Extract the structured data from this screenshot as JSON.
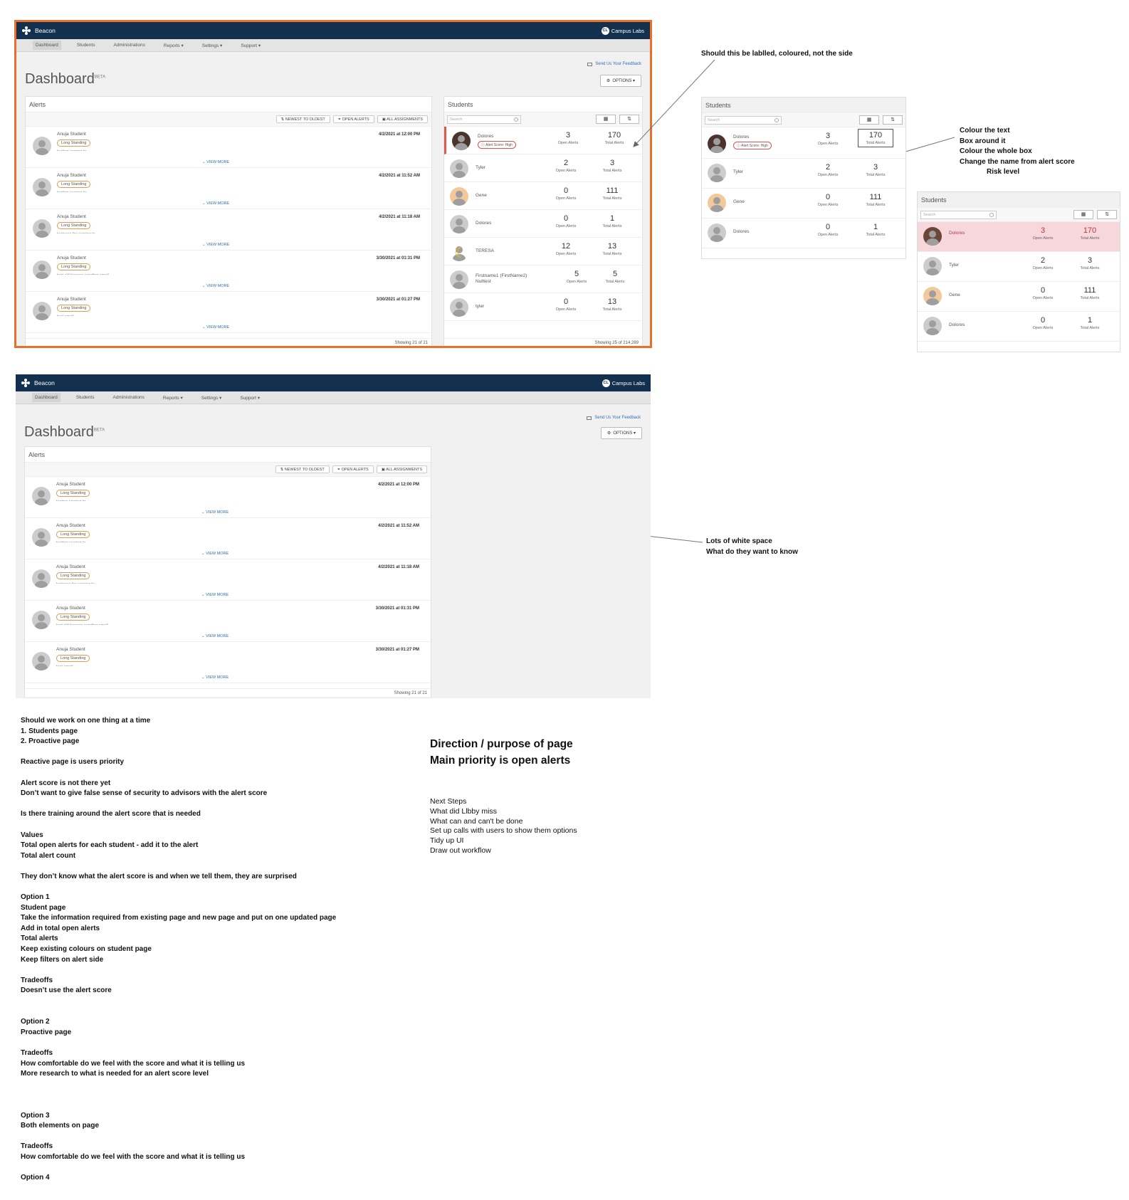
{
  "app": {
    "brand": "Beacon",
    "partner": "Campus Labs",
    "partner_initials": "CL",
    "nav": [
      "Dashboard",
      "Students",
      "Administrations",
      "Reports ▾",
      "Settings ▾",
      "Support ▾"
    ],
    "feedback": "Send Us Your Feedback",
    "title": "Dashboard",
    "title_sup": "BETA",
    "options": "OPTIONS ▾"
  },
  "alerts_panel": {
    "title": "Alerts",
    "filters": [
      "⇅  NEWEST TO OLDEST",
      "⏷  OPEN ALERTS",
      "▣  ALL ASSIGNMENTS"
    ],
    "rows": [
      {
        "name": "Anuja Student",
        "badge": "Long Standing",
        "date": "4/2/2021 at 12:00 PM",
        "comment": "testing scoring to"
      },
      {
        "name": "Anuja Student",
        "badge": "Long Standing",
        "date": "4/2/2021 at 11:52 AM",
        "comment": "testing scoring to"
      },
      {
        "name": "Anuja Student",
        "badge": "Long Standing",
        "date": "4/2/2021 at 11:18 AM",
        "comment": "testcase for scoring to"
      },
      {
        "name": "Anuja Student",
        "badge": "Long Standing",
        "date": "3/30/2021 at 01:31 PM",
        "comment": "test old beacon sending email"
      },
      {
        "name": "Anuja Student",
        "badge": "Long Standing",
        "date": "3/30/2021 at 01:27 PM",
        "comment": "test email"
      }
    ],
    "view_more": "⌄ VIEW MORE",
    "footer": "Showing 21 of 21"
  },
  "students_panel": {
    "title": "Students",
    "search_placeholder": "Search",
    "calendar_icon": "▦",
    "sort_icon": "⇅",
    "open_label": "Open Alerts",
    "total_label": "Total Alerts",
    "score_badge": "Alert Score: High",
    "rows": [
      {
        "name": "Dolores",
        "open": "3",
        "total": "170"
      },
      {
        "name": "Tyler",
        "open": "2",
        "total": "3"
      },
      {
        "name": "Gene",
        "open": "0",
        "total": "111"
      },
      {
        "name": "Dolores",
        "open": "0",
        "total": "1"
      },
      {
        "name": "TERESA",
        "open": "12",
        "total": "13"
      },
      {
        "name": "Firstname1 (FirstName2) Nulltest",
        "open": "5",
        "total": "5"
      },
      {
        "name": "tyler",
        "open": "0",
        "total": "13"
      }
    ],
    "footer": "Showing 25 of 214,269"
  },
  "annotations": {
    "label_question": "Should this be lablled, coloured, not the side",
    "colour_notes": [
      "Colour the text",
      "Box around it",
      "Colour the whole box",
      "Change the name from alert score",
      "Risk level"
    ],
    "whitespace_notes": [
      "Lots of white space",
      "What do they want to know"
    ]
  },
  "notes": [
    "Should we work on one thing at a time",
    "1. Students page",
    "2. Proactive page",
    "",
    "Reactive page is users priority",
    "",
    "Alert score is not there yet",
    "Don’t want to give false sense of security to advisors with the alert score",
    "",
    "Is there training around the alert score that is needed",
    "",
    "Values",
    "Total open alerts for each student - add it to the alert",
    "Total alert count",
    "",
    "They don’t know what the alert score is and when we tell them, they are surprised",
    "",
    "Option 1",
    "Student page",
    "Take the information required from existing page and new page and put on one updated page",
    "Add in total open alerts",
    "Total alerts",
    "Keep existing colours on student page",
    "Keep filters on alert side",
    "",
    "Tradeoffs",
    "Doesn’t use the alert score",
    "",
    "",
    "Option 2",
    "Proactive page",
    "",
    "Tradeoffs",
    "How comfortable do we feel with the score and what it is telling us",
    "More research to what is needed for an alert score level",
    "",
    "",
    "",
    "Option 3",
    "Both elements on page",
    "",
    "Tradeoffs",
    "How comfortable do we feel with the score and what it is telling us",
    "",
    "Option 4"
  ],
  "direction": [
    "Direction / purpose of page",
    "Main priority is open alerts"
  ],
  "next_steps": [
    "Next Steps",
    "What did Llbby miss",
    "What can and can't be done",
    "Set up calls with users to show them options",
    "Tidy up UI",
    "Draw out workflow"
  ],
  "colors": {
    "navy": "#14304f",
    "orange_frame": "#e8702a",
    "badge_orange": "#e09a4e",
    "alert_red": "#d9534f",
    "highlight_pink": "#f7d7db",
    "link_blue": "#2d6fb4"
  }
}
